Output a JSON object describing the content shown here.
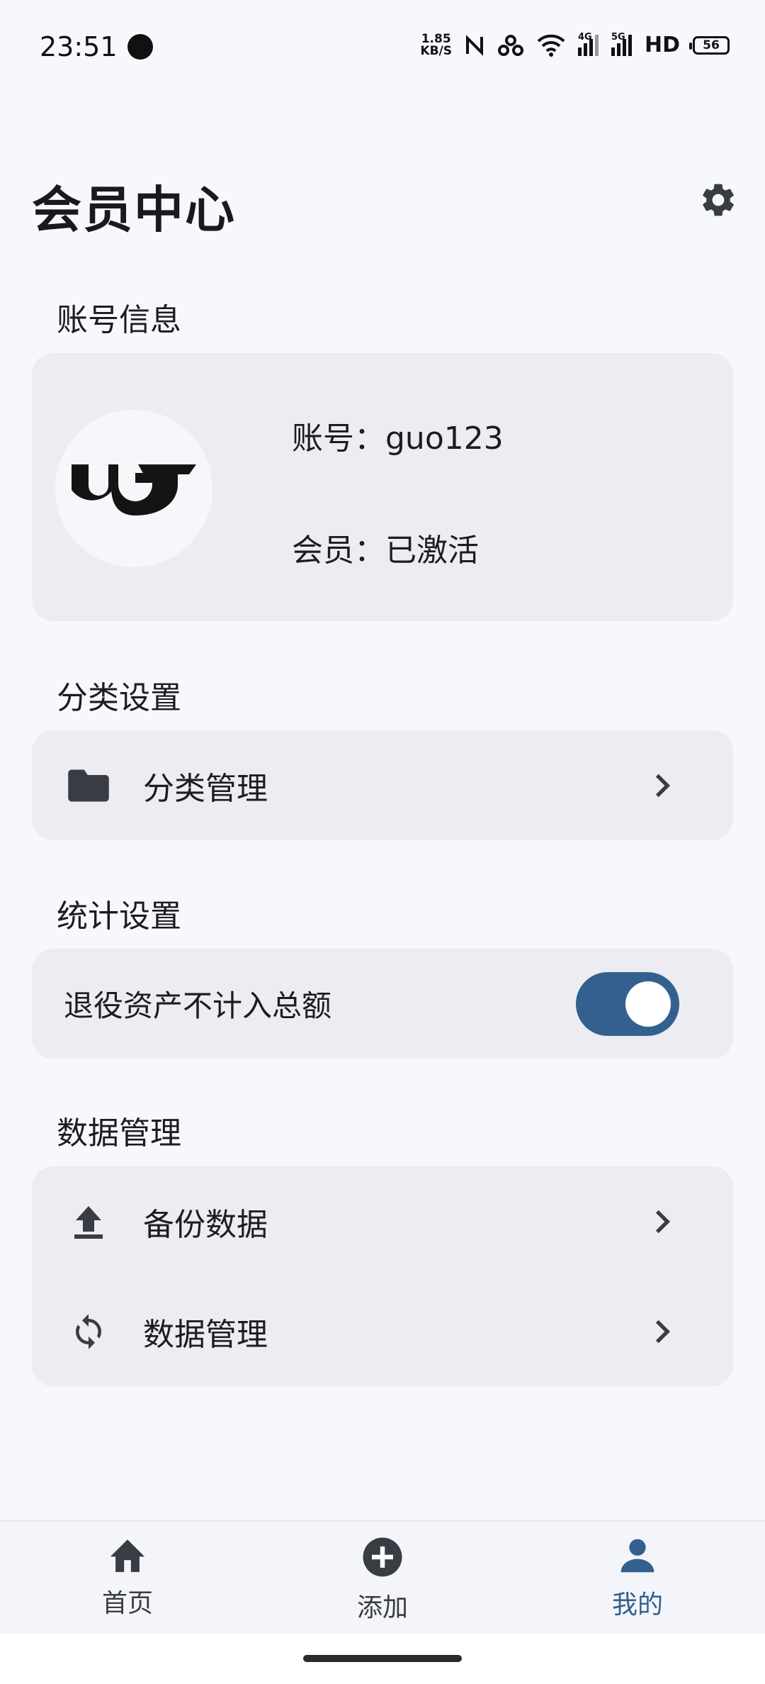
{
  "status_bar": {
    "time": "23:51",
    "net_speed_value": "1.85",
    "net_speed_unit": "KB/S",
    "network_4g": "4G",
    "network_5g": "5G",
    "hd": "HD",
    "battery": "56"
  },
  "header": {
    "title": "会员中心",
    "settings_icon": "gear-icon"
  },
  "account": {
    "section_title": "账号信息",
    "account_line": "账号：guo123",
    "member_line": "会员：已激活",
    "avatar_icon": "brand-logo"
  },
  "category": {
    "section_title": "分类设置",
    "manage_label": "分类管理",
    "manage_icon": "folder-icon"
  },
  "stats": {
    "section_title": "统计设置",
    "toggle_label": "退役资产不计入总额",
    "toggle_on": true
  },
  "data": {
    "section_title": "数据管理",
    "items": [
      {
        "label": "备份数据",
        "icon": "upload-icon"
      },
      {
        "label": "数据管理",
        "icon": "sync-icon"
      }
    ]
  },
  "bottom_nav": {
    "items": [
      {
        "label": "首页",
        "icon": "home-icon",
        "active": false
      },
      {
        "label": "添加",
        "icon": "add-circle-icon",
        "active": false
      },
      {
        "label": "我的",
        "icon": "person-icon",
        "active": true
      }
    ]
  },
  "colors": {
    "accent": "#33608f",
    "background": "#f7f8fd",
    "card": "#ececf2",
    "icon": "#3a3c44"
  }
}
